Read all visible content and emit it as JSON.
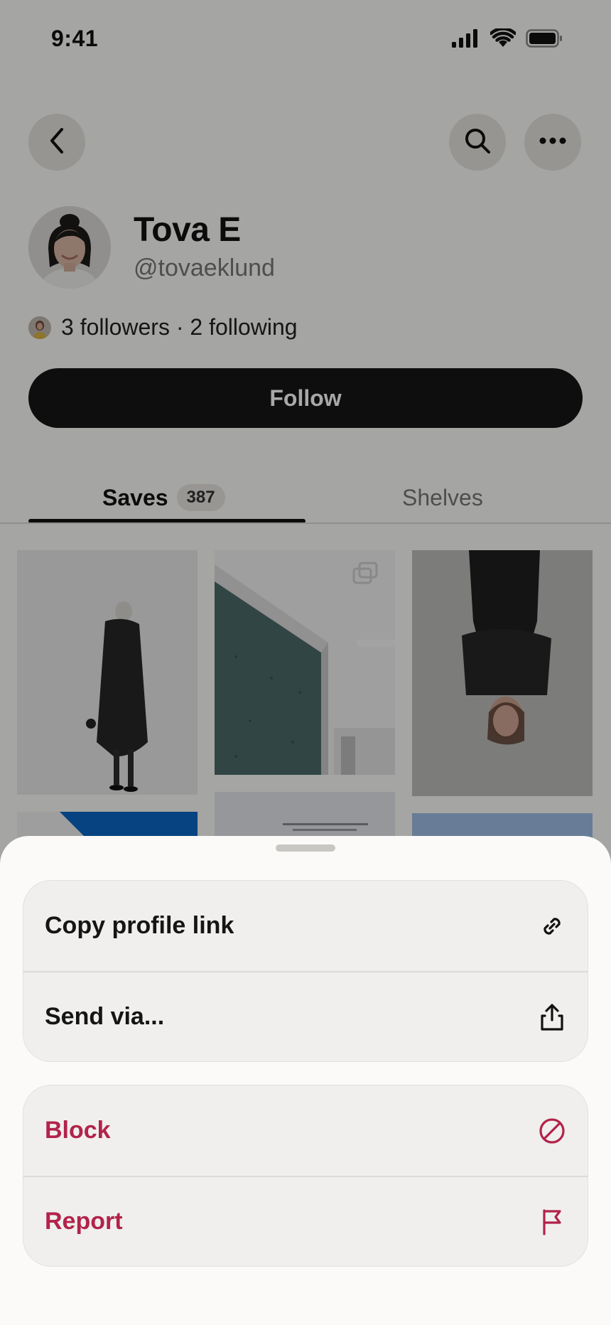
{
  "status_bar": {
    "time": "9:41"
  },
  "header": {
    "back_icon": "chevron-left-icon",
    "search_icon": "search-icon",
    "more_icon": "more-horizontal-icon"
  },
  "profile": {
    "name": "Tova E",
    "handle": "@tovaeklund",
    "followers_text": "3 followers · 2 following",
    "follow_label": "Follow"
  },
  "tabs": {
    "saves_label": "Saves",
    "saves_count": "387",
    "shelves_label": "Shelves",
    "active": "Saves"
  },
  "sheet": {
    "groups": [
      {
        "items": [
          {
            "label": "Copy profile link",
            "icon": "link-icon"
          },
          {
            "label": "Send via...",
            "icon": "share-icon"
          }
        ]
      },
      {
        "items": [
          {
            "label": "Block",
            "icon": "block-icon",
            "destructive": true
          },
          {
            "label": "Report",
            "icon": "flag-icon",
            "destructive": true
          }
        ]
      }
    ]
  },
  "colors": {
    "destructive": "#b2234a",
    "primary_button": "#161616",
    "sheet_background": "#fbfaf8"
  }
}
